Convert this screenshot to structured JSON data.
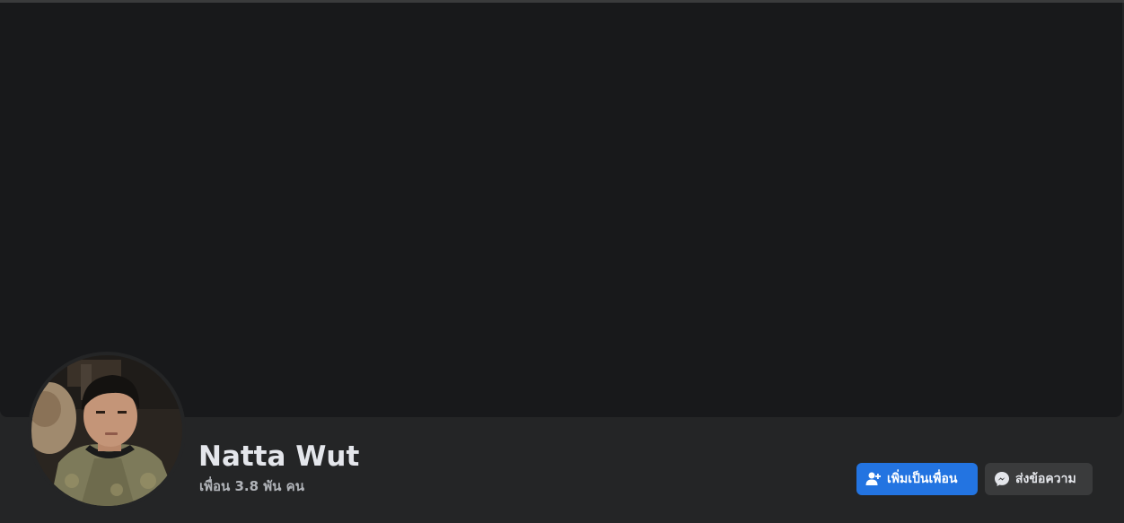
{
  "profile": {
    "name": "Natta Wut",
    "friends_count_text": "เพื่อน 3.8 พัน คน"
  },
  "actions": {
    "add_friend_label": "เพิ่มเป็นเพื่อน",
    "message_label": "ส่งข้อความ"
  },
  "icons": {
    "add_friend": "add-friend-icon",
    "messenger": "messenger-icon"
  },
  "colors": {
    "background": "#242526",
    "cover": "#18191b",
    "primary_button": "#2374e1",
    "secondary_button": "#3a3b3c",
    "name_text": "#e4e6eb",
    "secondary_text": "#b0b3b8"
  }
}
